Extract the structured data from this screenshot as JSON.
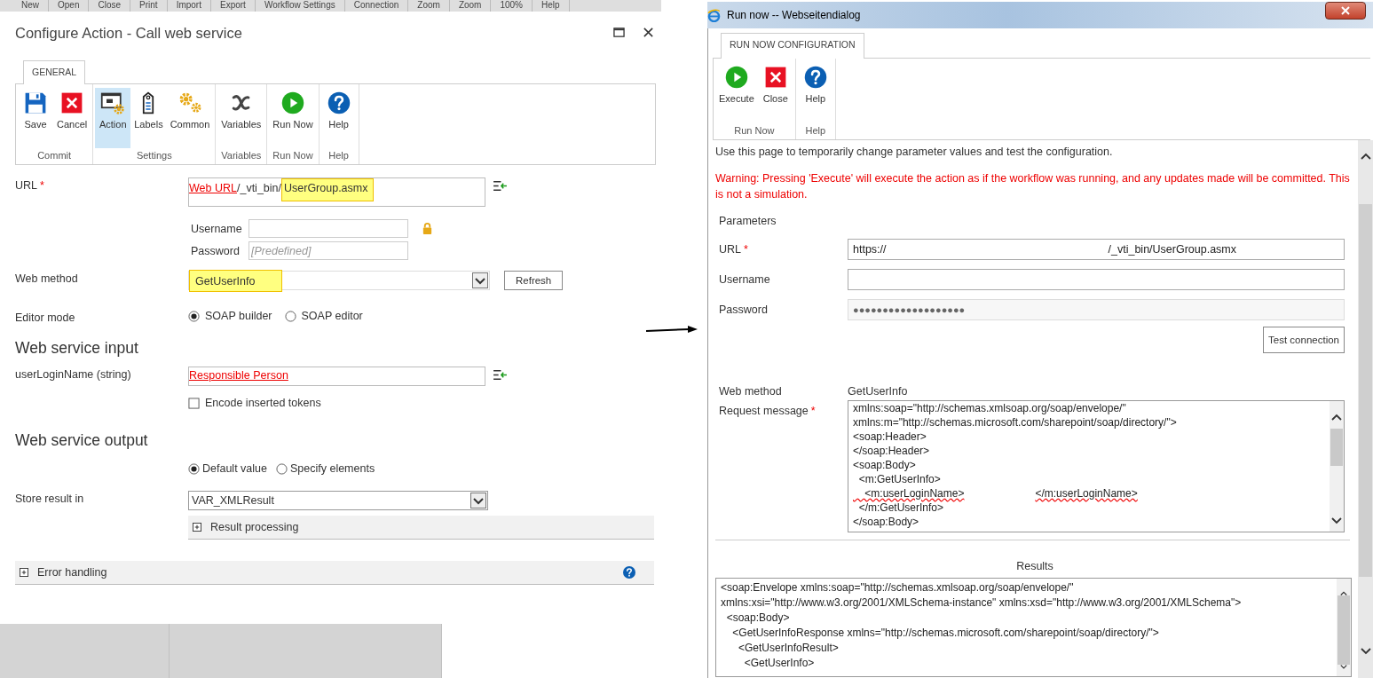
{
  "background_app": {
    "menu": [
      "New",
      "Open",
      "Close",
      "Print",
      "Import",
      "Export",
      "Workflow Settings",
      "Connection",
      "Zoom",
      "Zoom",
      "100%",
      "Help"
    ]
  },
  "configure_dialog": {
    "title": "Configure Action - Call web service",
    "tabs": [
      {
        "label": "GENERAL",
        "selected": true
      }
    ],
    "ribbon_groups": [
      {
        "name": "Commit",
        "buttons": [
          {
            "label": "Save",
            "kind": "save",
            "selected": false
          },
          {
            "label": "Cancel",
            "kind": "cancel",
            "selected": false
          }
        ]
      },
      {
        "name": "Settings",
        "buttons": [
          {
            "label": "Action",
            "kind": "action",
            "selected": true
          },
          {
            "label": "Labels",
            "kind": "labels",
            "selected": false
          },
          {
            "label": "Common",
            "kind": "common",
            "selected": false
          }
        ]
      },
      {
        "name": "Variables",
        "buttons": [
          {
            "label": "Variables",
            "kind": "variables",
            "selected": false
          }
        ]
      },
      {
        "name": "Run Now",
        "buttons": [
          {
            "label": "Run Now",
            "kind": "run",
            "selected": false
          }
        ]
      },
      {
        "name": "Help",
        "buttons": [
          {
            "label": "Help",
            "kind": "help",
            "selected": false
          }
        ]
      }
    ],
    "url": {
      "label": "URL",
      "required_mark": "*",
      "token": "Web URL",
      "path": "/_vti_bin/",
      "highlight": "UserGroup.asmx"
    },
    "username": {
      "label": "Username"
    },
    "password": {
      "label": "Password",
      "placeholder": "[Predefined]"
    },
    "web_method": {
      "label": "Web method",
      "value": "GetUserInfo",
      "button": "Refresh"
    },
    "editor_mode": {
      "label": "Editor mode",
      "options": [
        {
          "label": "SOAP builder",
          "selected": true
        },
        {
          "label": "SOAP editor",
          "selected": false
        }
      ]
    },
    "input_heading": "Web service input",
    "parameters": [
      {
        "label": "userLoginName (string)",
        "token": "Responsible Person"
      }
    ],
    "encode_tokens": {
      "label": "Encode inserted tokens",
      "checked": false
    },
    "output_heading": "Web service output",
    "output_mode": {
      "options": [
        {
          "label": "Default value",
          "selected": true
        },
        {
          "label": "Specify elements",
          "selected": false
        }
      ]
    },
    "store_result": {
      "label": "Store result in",
      "value": "VAR_XMLResult"
    },
    "result_processing": {
      "label": "Result processing",
      "expanded": false
    },
    "error_handling": {
      "label": "Error handling",
      "expanded": false
    }
  },
  "run_now_dialog": {
    "title": "Run now -- Webseitendialog",
    "tabs": [
      {
        "label": "RUN NOW CONFIGURATION",
        "selected": true
      }
    ],
    "ribbon_groups": [
      {
        "name": "Run Now",
        "buttons": [
          {
            "label": "Execute",
            "kind": "run",
            "selected": false
          },
          {
            "label": "Close",
            "kind": "cancel",
            "selected": false
          }
        ]
      },
      {
        "name": "Help",
        "buttons": [
          {
            "label": "Help",
            "kind": "help",
            "selected": false
          }
        ]
      }
    ],
    "intro": "Use this page to temporarily change parameter values and test the configuration.",
    "warning": "Warning: Pressing 'Execute' will execute the action as if the workflow was running, and any updates made will be committed. This is not a simulation.",
    "parameters_heading": "Parameters",
    "url": {
      "label": "URL",
      "required_mark": "*",
      "start": "https://",
      "end": "/_vti_bin/UserGroup.asmx"
    },
    "username": {
      "label": "Username"
    },
    "password": {
      "label": "Password",
      "value": "●●●●●●●●●●●●●●●●●●●"
    },
    "test_button": "Test connection",
    "web_method": {
      "label": "Web method",
      "value": "GetUserInfo"
    },
    "request": {
      "label": "Request message",
      "required_mark": "*",
      "lines": [
        {
          "kind": "text",
          "text": "xmlns:soap=\"http://schemas.xmlsoap.org/soap/envelope/\""
        },
        {
          "kind": "text",
          "text": "xmlns:m=\"http://schemas.microsoft.com/sharepoint/soap/directory/\">"
        },
        {
          "kind": "text",
          "text": "<soap:Header>"
        },
        {
          "kind": "text",
          "text": "</soap:Header>"
        },
        {
          "kind": "text",
          "text": "<soap:Body>"
        },
        {
          "kind": "text",
          "text": "  <m:GetUserInfo>"
        },
        {
          "kind": "redacted",
          "open": "    <m:userLoginName>",
          "close": "</m:userLoginName>"
        },
        {
          "kind": "text",
          "text": "  </m:GetUserInfo>"
        },
        {
          "kind": "text",
          "text": "</soap:Body>"
        }
      ]
    },
    "results": {
      "label": "Results",
      "lines": [
        "<soap:Envelope xmlns:soap=\"http://schemas.xmlsoap.org/soap/envelope/\"",
        "xmlns:xsi=\"http://www.w3.org/2001/XMLSchema-instance\" xmlns:xsd=\"http://www.w3.org/2001/XMLSchema\">",
        "  <soap:Body>",
        "    <GetUserInfoResponse xmlns=\"http://schemas.microsoft.com/sharepoint/soap/directory/\">",
        "      <GetUserInfoResult>",
        "        <GetUserInfo>"
      ]
    }
  }
}
